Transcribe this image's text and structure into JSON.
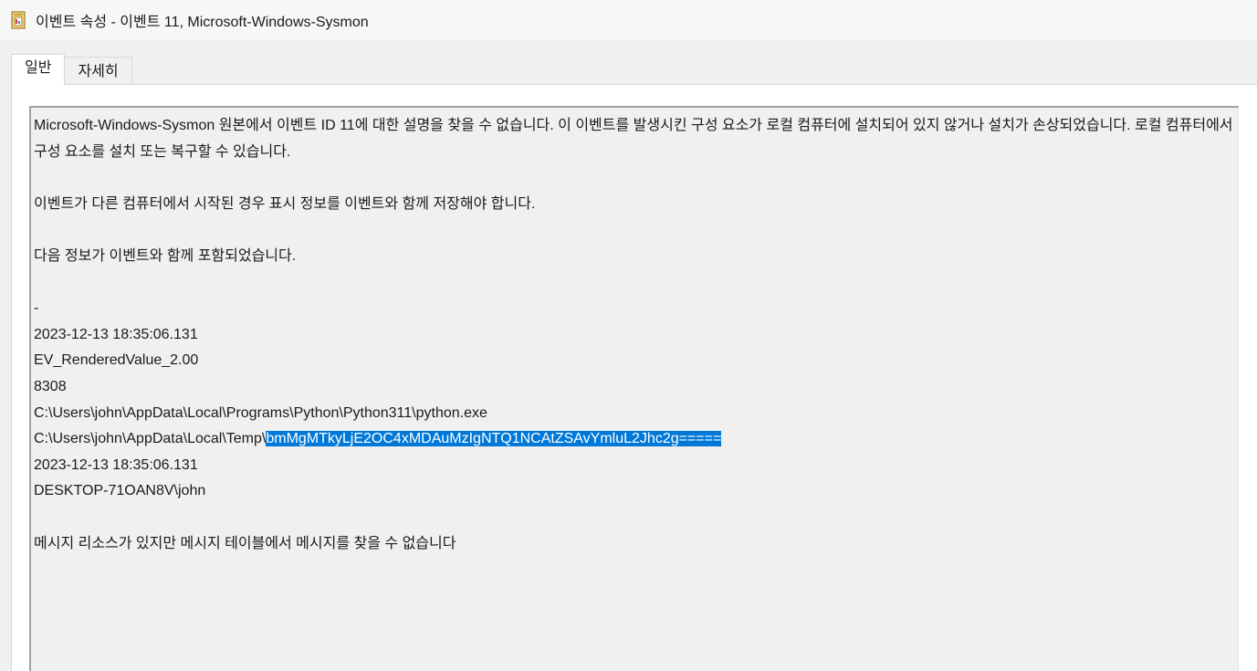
{
  "window": {
    "title": "이벤트 속성 - 이벤트 11, Microsoft-Windows-Sysmon",
    "icon": "event-properties-icon"
  },
  "tabs": [
    {
      "label": "일반",
      "active": true
    },
    {
      "label": "자세히",
      "active": false
    }
  ],
  "description": {
    "paragraph1": "Microsoft-Windows-Sysmon 원본에서 이벤트 ID 11에 대한 설명을 찾을 수 없습니다. 이 이벤트를 발생시킨 구성 요소가 로컬 컴퓨터에 설치되어 있지 않거나 설치가 손상되었습니다. 로컬 컴퓨터에서 구성 요소를 설치 또는 복구할 수 있습니다.",
    "paragraph2": "이벤트가 다른 컴퓨터에서 시작된 경우 표시 정보를 이벤트와 함께 저장해야 합니다.",
    "paragraph3": "다음 정보가 이벤트와 함께 포함되었습니다.",
    "values": [
      "-",
      "2023-12-13 18:35:06.131",
      "EV_RenderedValue_2.00",
      "8308",
      "C:\\Users\\john\\AppData\\Local\\Programs\\Python\\Python311\\python.exe"
    ],
    "target_path_prefix": "C:\\Users\\john\\AppData\\Local\\Temp\\",
    "target_path_selected": "bmMgMTkyLjE2OC4xMDAuMzIgNTQ1NCAtZSAvYmluL2Jhc2g=====",
    "values_after": [
      "2023-12-13 18:35:06.131",
      "DESKTOP-71OAN8V\\john"
    ],
    "footer": "메시지 리소스가 있지만 메시지 테이블에서 메시지를 찾을 수 없습니다"
  },
  "colors": {
    "selection": "#0078d7",
    "background": "#f0f0f0"
  }
}
